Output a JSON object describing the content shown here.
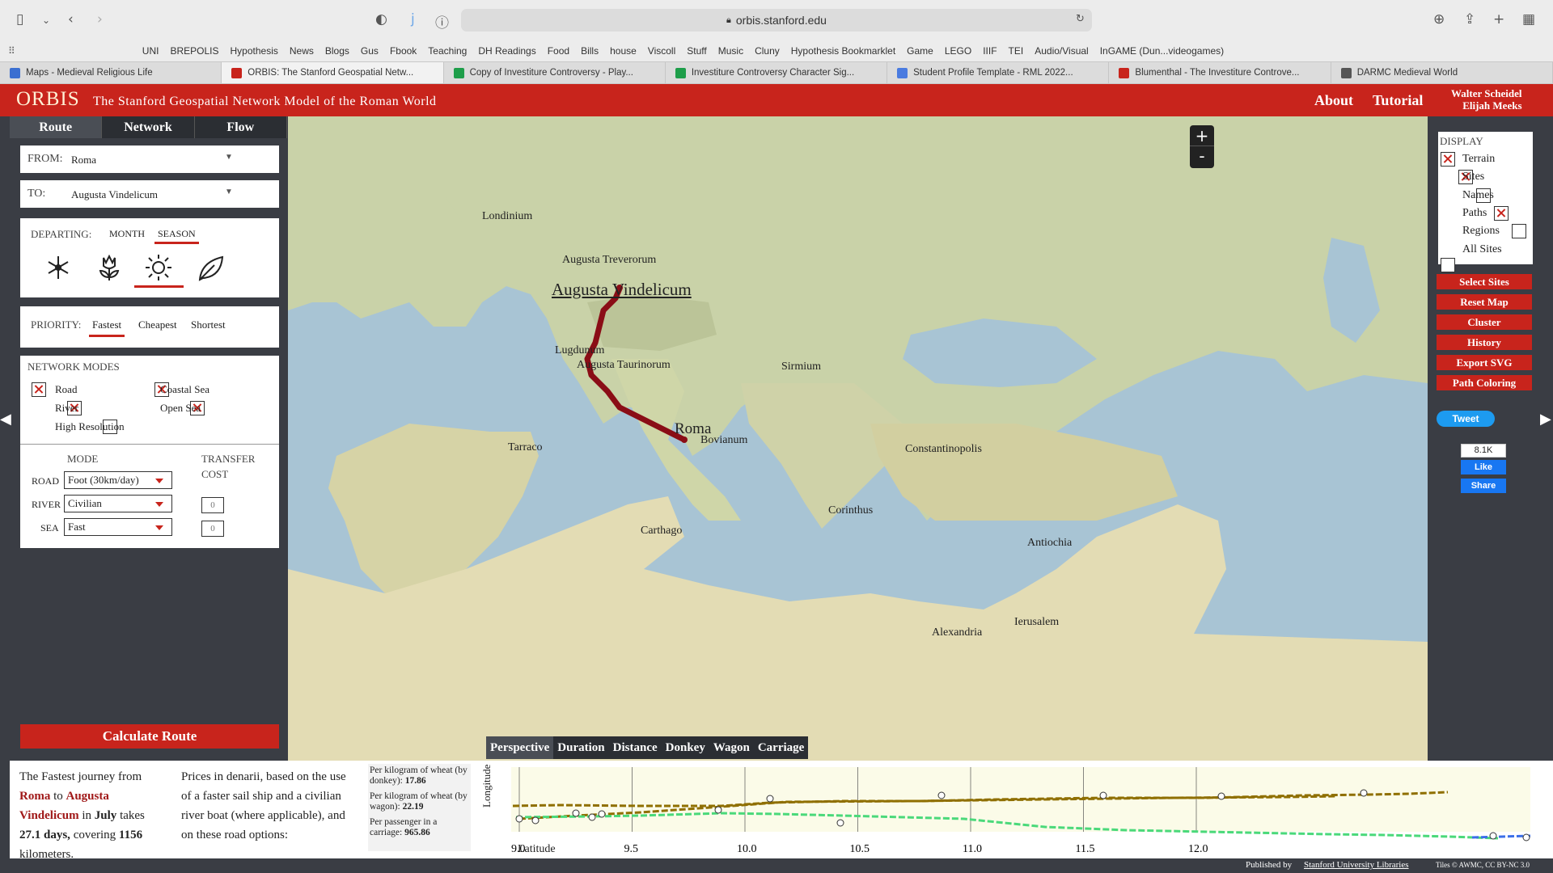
{
  "browser": {
    "url": "orbis.stanford.edu",
    "bookmarks": [
      "UNI",
      "BREPOLIS",
      "Hypothesis",
      "News",
      "Blogs",
      "Gus",
      "Fbook",
      "Teaching",
      "DH Readings",
      "Food",
      "Bills",
      "house",
      "Viscoll",
      "Stuff",
      "Music",
      "Cluny",
      "Hypothesis Bookmarklet",
      "Game",
      "LEGO",
      "IIIF",
      "TEI",
      "Audio/Visual",
      "InGAME (Dun...videogames)"
    ],
    "tabs": [
      {
        "title": "Maps - Medieval Religious Life",
        "color": "#3b6fd1"
      },
      {
        "title": "ORBIS: The Stanford Geospatial Netw...",
        "color": "#c8241c"
      },
      {
        "title": "Copy of Investiture Controversy - Play...",
        "color": "#1e9e4a"
      },
      {
        "title": "Investiture Controversy Character Sig...",
        "color": "#1e9e4a"
      },
      {
        "title": "Student Profile Template - RML 2022...",
        "color": "#4a7be0"
      },
      {
        "title": "Blumenthal - The Investiture Controve...",
        "color": "#c8241c"
      },
      {
        "title": "DARMC Medieval World",
        "color": "#555555"
      }
    ]
  },
  "header": {
    "logo": "ORBIS",
    "subtitle": "The Stanford Geospatial Network Model of the Roman World",
    "about": "About",
    "tutorial": "Tutorial",
    "author1": "Walter Scheidel",
    "author2": "Elijah Meeks"
  },
  "panel": {
    "tabs": [
      "Route",
      "Network",
      "Flow"
    ],
    "from_label": "FROM:",
    "from_value": "Roma",
    "to_label": "TO:",
    "to_value": "Augusta Vindelicum",
    "departing_label": "DEPARTING:",
    "month": "MONTH",
    "season": "SEASON",
    "seasons": [
      "winter-icon",
      "spring-icon",
      "summer-icon",
      "autumn-icon"
    ],
    "priority_label": "PRIORITY:",
    "priorities": [
      "Fastest",
      "Cheapest",
      "Shortest"
    ],
    "network_label": "NETWORK MODES",
    "modes": {
      "road": "Road",
      "river": "River",
      "high_res": "High Resolution",
      "coastal": "Coastal Sea",
      "open": "Open Sea"
    },
    "mode_header": "MODE",
    "transfer_header1": "TRANSFER",
    "transfer_header2": "COST",
    "road_label": "ROAD",
    "road_value": "Foot (30km/day)",
    "river_label": "RIVER",
    "river_value": "Civilian",
    "sea_label": "SEA",
    "sea_value": "Fast",
    "river_cost": "0",
    "sea_cost": "0",
    "calc": "Calculate Route"
  },
  "map": {
    "zoom_in": "+",
    "zoom_out": "-",
    "labels": [
      {
        "text": "Londinium",
        "size": 14
      },
      {
        "text": "Augusta Treverorum",
        "size": 14
      },
      {
        "text": "Augusta Vindelicum",
        "size": 21
      },
      {
        "text": "Lugdunum",
        "size": 14
      },
      {
        "text": "Augusta Taurinorum",
        "size": 14
      },
      {
        "text": "Sirmium",
        "size": 14
      },
      {
        "text": "Roma",
        "size": 19
      },
      {
        "text": "Bovianum",
        "size": 14
      },
      {
        "text": "Tarraco",
        "size": 14
      },
      {
        "text": "Constantinopolis",
        "size": 14
      },
      {
        "text": "Corinthus",
        "size": 14
      },
      {
        "text": "Carthago",
        "size": 14
      },
      {
        "text": "Antiochia",
        "size": 14
      },
      {
        "text": "Alexandria",
        "size": 14
      },
      {
        "text": "Ierusalem",
        "size": 14
      }
    ]
  },
  "display": {
    "title": "DISPLAY",
    "items": [
      {
        "label": "Terrain",
        "on": true
      },
      {
        "label": "Sites",
        "on": true
      },
      {
        "label": "Names",
        "on": false
      },
      {
        "label": "Paths",
        "on": true
      },
      {
        "label": "Regions",
        "on": false
      },
      {
        "label": "All Sites",
        "on": false
      }
    ],
    "buttons": [
      "Select Sites",
      "Reset Map",
      "Cluster",
      "History",
      "Export SVG",
      "Path Coloring"
    ],
    "tweet": "Tweet",
    "fb_count": "8.1K",
    "like": "Like",
    "share": "Share"
  },
  "graph": {
    "tabs": [
      "Perspective",
      "Duration",
      "Distance",
      "Donkey",
      "Wagon",
      "Carriage"
    ],
    "ylabel": "Longitude",
    "xlabel": "Latitude",
    "ticks": [
      "9.0",
      "9.5",
      "10.0",
      "10.5",
      "11.0",
      "11.5",
      "12.0"
    ]
  },
  "summary": {
    "p1": "The Fastest journey from",
    "from": "Roma",
    "to_word": "to",
    "to": "Augusta Vindelicum",
    "in_word": "in",
    "month": "July",
    "takes": "takes",
    "days": "27.1 days,",
    "covering": "covering",
    "km": "1156",
    "km_label": "kilometers.",
    "prices": "Prices in denarii, based on the use of a faster sail ship and a civilian river boat (where applicable), and on these road options:",
    "wheat_donkey_label": "Per kilogram of wheat (by donkey):",
    "wheat_donkey": "17.86",
    "wheat_wagon_label": "Per kilogram of wheat (by wagon):",
    "wheat_wagon": "22.19",
    "passenger_label": "Per passenger in a carriage:",
    "passenger": "965.86"
  },
  "footer": {
    "published": "Published by",
    "library": "Stanford University Libraries",
    "tiles": "Tiles © AWMC, CC BY-NC 3.0"
  }
}
